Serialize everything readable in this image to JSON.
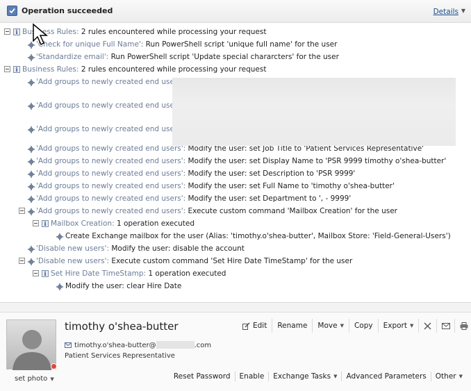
{
  "operation": {
    "status_title": "Operation succeeded",
    "details_label": "Details"
  },
  "log": [
    {
      "toggle": true,
      "icon": "info",
      "key": "Business Rules:",
      "value": " 2 rules encountered while processing your request"
    },
    {
      "icon": "gear",
      "key": "'Check for unique Full Name':",
      "value": " Run PowerShell script 'unique full name' for the user"
    },
    {
      "icon": "gear",
      "key": "'Standardize email':",
      "value": " Run PowerShell script 'Update special chararcters' for the user"
    },
    {
      "toggle": true,
      "icon": "info",
      "key": "Business Rules:",
      "value": " 2 rules encountered while processing your request"
    },
    {
      "icon": "gear",
      "key": "'Add groups to newly created end users':",
      "value": ""
    },
    {
      "icon": "gear",
      "key": "'Add groups to newly created end users':",
      "value": ""
    },
    {
      "icon": "gear",
      "key": "'Add groups to newly created end users':",
      "value": ""
    },
    {
      "icon": "gear",
      "key": "'Add groups to newly created end users':",
      "value": " Modify the user: set Job Title to 'Patient Services Representative'"
    },
    {
      "icon": "gear",
      "key": "'Add groups to newly created end users':",
      "value": " Modify the user: set Display Name to 'PSR 9999 timothy o'shea-butter'"
    },
    {
      "icon": "gear",
      "key": "'Add groups to newly created end users':",
      "value": " Modify the user: set Description to 'PSR 9999'"
    },
    {
      "icon": "gear",
      "key": "'Add groups to newly created end users':",
      "value": " Modify the user: set Full Name to 'timothy o'shea-butter'"
    },
    {
      "icon": "gear",
      "key": "'Add groups to newly created end users':",
      "value": " Modify the user: set Department to ', - 9999'"
    },
    {
      "toggle": true,
      "icon": "gear",
      "key": "'Add groups to newly created end users':",
      "value": " Execute custom command 'Mailbox Creation' for the user"
    },
    {
      "toggle": true,
      "icon": "info",
      "key": "Mailbox Creation:",
      "value": " 1 operation executed"
    },
    {
      "icon": "gear",
      "key": "",
      "value": "Create Exchange mailbox for the user (Alias: 'timothy.o'shea-butter', Mailbox Store: 'Field-General-Users')"
    },
    {
      "icon": "gear",
      "key": "'Disable new users':",
      "value": " Modify the user: disable the account"
    },
    {
      "toggle": true,
      "icon": "gear",
      "key": "'Disable new users':",
      "value": " Execute custom command 'Set Hire Date TimeStamp' for the user"
    },
    {
      "toggle": true,
      "icon": "info",
      "key": "Set Hire Date TimeStamp:",
      "value": " 1 operation executed"
    },
    {
      "icon": "gear",
      "key": "",
      "value": "Modify the user: clear Hire Date"
    }
  ],
  "user": {
    "name": "timothy o'shea-butter",
    "email_prefix": "timothy.o'shea-butter@",
    "email_suffix": ".com",
    "job_title": "Patient Services Representative",
    "set_photo_label": "set photo"
  },
  "toolbar": {
    "edit": "Edit",
    "rename": "Rename",
    "move": "Move",
    "copy": "Copy",
    "export": "Export"
  },
  "bottom_actions": {
    "reset_password": "Reset Password",
    "enable": "Enable",
    "exchange_tasks": "Exchange Tasks",
    "advanced_parameters": "Advanced Parameters",
    "other": "Other"
  },
  "colors": {
    "key_text": "#6c7c97",
    "link": "#1a4e8a",
    "status_red": "#e0463a"
  }
}
